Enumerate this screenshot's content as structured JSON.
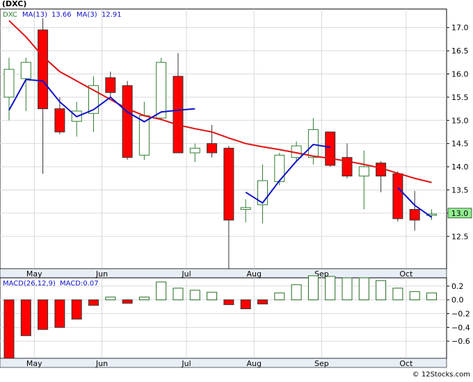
{
  "header": {
    "ticker": "(DXC)",
    "legend_symbol": "DXC",
    "ma13_label": "MA(13)",
    "ma13_value": "13.66",
    "ma3_label": "MA(3)",
    "ma3_value": "12.91",
    "macd_label": "MACD(26,12,9)",
    "macd_value_label": "MACD:0.07"
  },
  "footer": {
    "copyright": "© 12Stocks.com"
  },
  "colors": {
    "up_candle": "#2e7d32",
    "down_candle": "#ff0000",
    "ma13": "#e01010",
    "ma3": "#1010cc",
    "macd_pos": "#1f6b1f",
    "macd_neg": "#ff0000",
    "last_price_bg": "#90ee90",
    "panel_bg": "#ffffff",
    "xaxis_bg": "#e8eef6",
    "grid": "#d9d9d9"
  },
  "chart_data": [
    {
      "type": "candlestick",
      "title": "(DXC)",
      "ylim": [
        11.8,
        17.4
      ],
      "yticks": [
        12.5,
        13.0,
        13.5,
        14.0,
        14.5,
        15.0,
        15.5,
        16.0,
        16.5,
        17.0
      ],
      "ytick_labels": [
        "12.5",
        "13.0",
        "13.5",
        "14.0",
        "14.5",
        "15.0",
        "15.5",
        "16.0",
        "16.5",
        "17.0"
      ],
      "last_price_label": "13.0",
      "last_price": 13.0,
      "x_labels": [
        {
          "label": "May",
          "index": 1
        },
        {
          "label": "Jun",
          "index": 5
        },
        {
          "label": "Jul",
          "index": 10
        },
        {
          "label": "Aug",
          "index": 14
        },
        {
          "label": "Sep",
          "index": 18
        },
        {
          "label": "Oct",
          "index": 23
        }
      ],
      "candles": [
        {
          "o": 15.5,
          "h": 16.35,
          "l": 15.0,
          "c": 16.1
        },
        {
          "o": 15.9,
          "h": 16.35,
          "l": 15.2,
          "c": 16.25
        },
        {
          "o": 16.95,
          "h": 17.2,
          "l": 13.85,
          "c": 15.25
        },
        {
          "o": 15.25,
          "h": 15.5,
          "l": 14.7,
          "c": 14.75
        },
        {
          "o": 14.98,
          "h": 15.4,
          "l": 14.65,
          "c": 15.2
        },
        {
          "o": 15.15,
          "h": 15.95,
          "l": 14.75,
          "c": 15.75
        },
        {
          "o": 15.92,
          "h": 16.05,
          "l": 15.5,
          "c": 15.6
        },
        {
          "o": 15.75,
          "h": 15.85,
          "l": 14.15,
          "c": 14.2
        },
        {
          "o": 14.25,
          "h": 15.4,
          "l": 14.15,
          "c": 15.1
        },
        {
          "o": 15.05,
          "h": 16.35,
          "l": 15.0,
          "c": 16.25
        },
        {
          "o": 15.95,
          "h": 16.45,
          "l": 14.3,
          "c": 14.3
        },
        {
          "o": 14.3,
          "h": 14.5,
          "l": 14.1,
          "c": 14.4
        },
        {
          "o": 14.5,
          "h": 14.9,
          "l": 14.2,
          "c": 14.3
        },
        {
          "o": 14.4,
          "h": 14.45,
          "l": 11.8,
          "c": 12.85
        },
        {
          "o": 13.08,
          "h": 13.3,
          "l": 12.8,
          "c": 13.12
        },
        {
          "o": 13.18,
          "h": 14.05,
          "l": 12.78,
          "c": 13.7
        },
        {
          "o": 13.68,
          "h": 14.3,
          "l": 13.6,
          "c": 14.25
        },
        {
          "o": 14.2,
          "h": 14.55,
          "l": 14.1,
          "c": 14.45
        },
        {
          "o": 14.2,
          "h": 15.05,
          "l": 14.05,
          "c": 14.8
        },
        {
          "o": 14.75,
          "h": 14.75,
          "l": 14.0,
          "c": 14.03
        },
        {
          "o": 14.2,
          "h": 14.5,
          "l": 13.75,
          "c": 13.8
        },
        {
          "o": 13.8,
          "h": 14.35,
          "l": 13.08,
          "c": 14.0
        },
        {
          "o": 14.08,
          "h": 14.12,
          "l": 13.45,
          "c": 13.8
        },
        {
          "o": 13.85,
          "h": 13.9,
          "l": 12.82,
          "c": 12.88
        },
        {
          "o": 13.08,
          "h": 13.48,
          "l": 12.62,
          "c": 12.85
        },
        {
          "o": 12.95,
          "h": 13.08,
          "l": 12.85,
          "c": 12.98
        }
      ],
      "series": [
        {
          "name": "MA(13)",
          "values": [
            17.15,
            16.8,
            16.38,
            16.05,
            15.85,
            15.65,
            15.45,
            15.25,
            15.1,
            15.02,
            14.9,
            14.82,
            14.75,
            14.62,
            14.5,
            14.43,
            14.37,
            14.3,
            14.23,
            14.18,
            14.12,
            14.05,
            13.97,
            13.86,
            13.75,
            13.66
          ]
        },
        {
          "name": "MA(3)",
          "values": [
            15.22,
            15.88,
            15.85,
            15.4,
            15.08,
            15.23,
            15.5,
            15.18,
            14.97,
            15.18,
            15.22,
            15.25,
            null,
            null,
            13.45,
            13.22,
            13.7,
            14.12,
            14.48,
            14.42,
            null,
            null,
            null,
            13.55,
            13.17,
            12.91
          ]
        }
      ]
    },
    {
      "type": "bar",
      "title": "MACD(26,12,9)",
      "ylim": [
        -0.85,
        0.32
      ],
      "yticks": [
        -0.6,
        -0.4,
        -0.2,
        0.0,
        0.2
      ],
      "ytick_labels": [
        "−0.6",
        "−0.4",
        "−0.2",
        "0.0",
        "0.2"
      ],
      "values": [
        -0.85,
        -0.52,
        -0.43,
        -0.4,
        -0.28,
        -0.08,
        0.04,
        -0.05,
        0.04,
        0.26,
        0.17,
        0.14,
        0.11,
        -0.07,
        -0.13,
        -0.06,
        0.1,
        0.22,
        0.35,
        0.34,
        0.32,
        0.32,
        0.28,
        0.17,
        0.12,
        0.1
      ]
    }
  ]
}
